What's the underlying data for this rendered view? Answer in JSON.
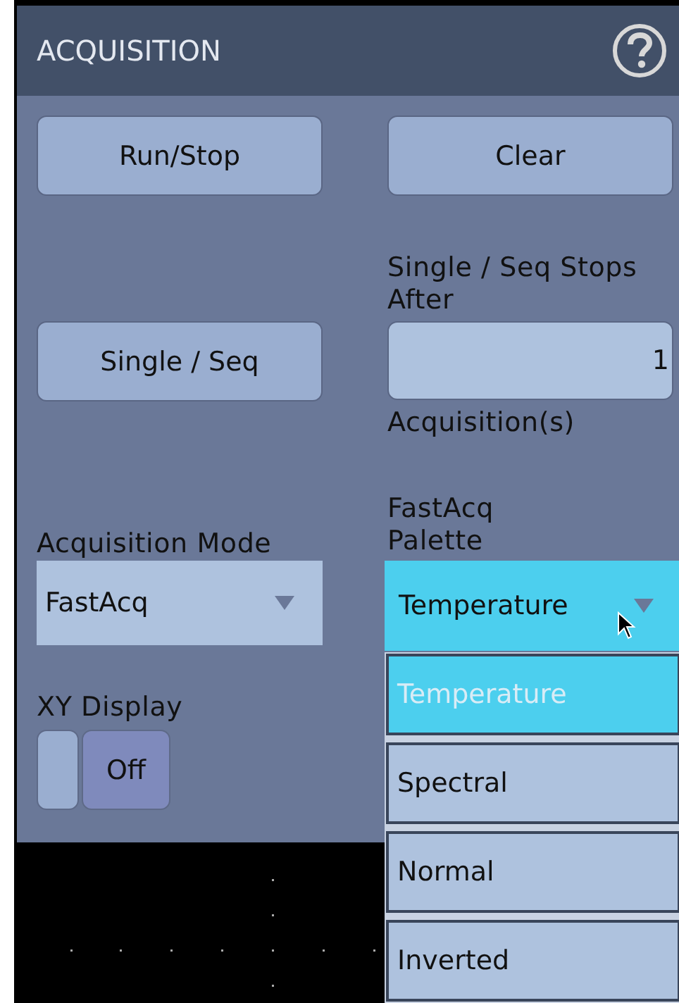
{
  "panel": {
    "title": "ACQUISITION"
  },
  "run_stop_button": {
    "label": "Run/Stop"
  },
  "clear_button": {
    "label": "Clear"
  },
  "single_seq_button": {
    "label": "Single / Seq"
  },
  "stop_after": {
    "label": "Single / Seq Stops After",
    "value": "1",
    "unit": "Acquisition(s)"
  },
  "acquisition_mode": {
    "label": "Acquisition Mode",
    "value": "FastAcq",
    "expanded": false
  },
  "fastacq_palette": {
    "label": "FastAcq Palette",
    "value": "Temperature",
    "expanded": true,
    "options": [
      {
        "label": "Temperature",
        "selected": true
      },
      {
        "label": "Spectral",
        "selected": false
      },
      {
        "label": "Normal",
        "selected": false
      },
      {
        "label": "Inverted",
        "selected": false
      }
    ]
  },
  "xy_display": {
    "label": "XY Display",
    "value": "Off",
    "on": false
  }
}
